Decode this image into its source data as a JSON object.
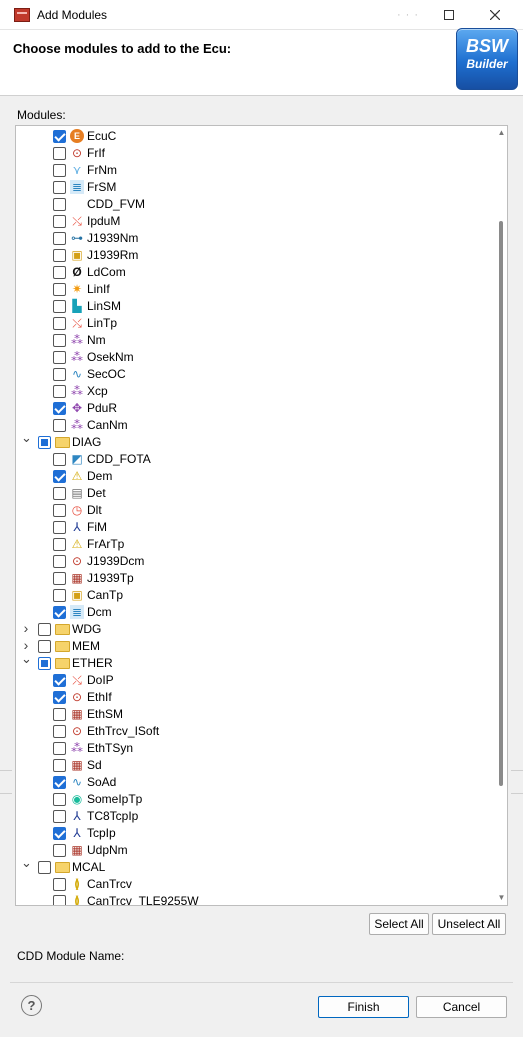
{
  "window": {
    "title": "Add Modules",
    "dots": "· · ·"
  },
  "header": {
    "title": "Choose modules to add to the Ecu:",
    "logo_line1": "BSW",
    "logo_line2": "Builder"
  },
  "modules_label": "Modules:",
  "tree": [
    {
      "label": "EcuC",
      "state": "checked",
      "icon": "ecuc-icon",
      "level": 1
    },
    {
      "label": "FrIf",
      "state": "unchecked",
      "icon": "interface-icon",
      "level": 1
    },
    {
      "label": "FrNm",
      "state": "unchecked",
      "icon": "network-icon",
      "level": 1
    },
    {
      "label": "FrSM",
      "state": "unchecked",
      "icon": "table-icon",
      "level": 1
    },
    {
      "label": "CDD_FVM",
      "state": "unchecked",
      "icon": "",
      "level": 1
    },
    {
      "label": "IpduM",
      "state": "unchecked",
      "icon": "multiplexer-icon",
      "level": 1
    },
    {
      "label": "J1939Nm",
      "state": "unchecked",
      "icon": "link-icon",
      "level": 1
    },
    {
      "label": "J1939Rm",
      "state": "unchecked",
      "icon": "box-icon",
      "level": 1
    },
    {
      "label": "LdCom",
      "state": "unchecked",
      "icon": "phi-icon",
      "level": 1
    },
    {
      "label": "LinIf",
      "state": "unchecked",
      "icon": "star-icon",
      "level": 1
    },
    {
      "label": "LinSM",
      "state": "unchecked",
      "icon": "page-icon",
      "level": 1
    },
    {
      "label": "LinTp",
      "state": "unchecked",
      "icon": "multiplexer-icon",
      "level": 1
    },
    {
      "label": "Nm",
      "state": "unchecked",
      "icon": "nodes-icon",
      "level": 1
    },
    {
      "label": "OsekNm",
      "state": "unchecked",
      "icon": "nodes-icon",
      "level": 1
    },
    {
      "label": "SecOC",
      "state": "unchecked",
      "icon": "wave-icon",
      "level": 1
    },
    {
      "label": "Xcp",
      "state": "unchecked",
      "icon": "nodes-icon",
      "level": 1
    },
    {
      "label": "PduR",
      "state": "checked",
      "icon": "router-icon",
      "level": 1
    },
    {
      "label": "CanNm",
      "state": "unchecked",
      "icon": "nodes-icon",
      "level": 1
    },
    {
      "label": "DIAG",
      "state": "partial",
      "icon": "folder-icon",
      "level": 0,
      "expander": "expanded"
    },
    {
      "label": "CDD_FOTA",
      "state": "unchecked",
      "icon": "puzzle-icon",
      "level": 1
    },
    {
      "label": "Dem",
      "state": "checked",
      "icon": "warning-icon",
      "level": 1
    },
    {
      "label": "Det",
      "state": "unchecked",
      "icon": "clipboard-icon",
      "level": 1
    },
    {
      "label": "Dlt",
      "state": "unchecked",
      "icon": "clock-icon",
      "level": 1
    },
    {
      "label": "FiM",
      "state": "unchecked",
      "icon": "tree-icon",
      "level": 1
    },
    {
      "label": "FrArTp",
      "state": "unchecked",
      "icon": "warning-icon",
      "level": 1
    },
    {
      "label": "J1939Dcm",
      "state": "unchecked",
      "icon": "interface-icon",
      "level": 1
    },
    {
      "label": "J1939Tp",
      "state": "unchecked",
      "icon": "cubes-icon",
      "level": 1
    },
    {
      "label": "CanTp",
      "state": "unchecked",
      "icon": "box-icon",
      "level": 1
    },
    {
      "label": "Dcm",
      "state": "checked",
      "icon": "table-icon",
      "level": 1
    },
    {
      "label": "WDG",
      "state": "unchecked",
      "icon": "folder-icon",
      "level": 0,
      "expander": "collapsed"
    },
    {
      "label": "MEM",
      "state": "unchecked",
      "icon": "folder-icon",
      "level": 0,
      "expander": "collapsed"
    },
    {
      "label": "ETHER",
      "state": "partial",
      "icon": "folder-icon",
      "level": 0,
      "expander": "expanded"
    },
    {
      "label": "DoIP",
      "state": "checked",
      "icon": "multiplexer-icon",
      "level": 1
    },
    {
      "label": "EthIf",
      "state": "checked",
      "icon": "interface-icon",
      "level": 1
    },
    {
      "label": "EthSM",
      "state": "unchecked",
      "icon": "cubes-icon",
      "level": 1
    },
    {
      "label": "EthTrcv_ISoft",
      "state": "unchecked",
      "icon": "interface-icon",
      "level": 1
    },
    {
      "label": "EthTSyn",
      "state": "unchecked",
      "icon": "nodes-icon",
      "level": 1
    },
    {
      "label": "Sd",
      "state": "unchecked",
      "icon": "cubes-icon",
      "level": 1
    },
    {
      "label": "SoAd",
      "state": "checked",
      "icon": "wave-icon",
      "level": 1
    },
    {
      "label": "SomeIpTp",
      "state": "unchecked",
      "icon": "signal-icon",
      "level": 1
    },
    {
      "label": "TC8TcpIp",
      "state": "unchecked",
      "icon": "tree-icon",
      "level": 1
    },
    {
      "label": "TcpIp",
      "state": "checked",
      "icon": "tree-icon",
      "level": 1
    },
    {
      "label": "UdpNm",
      "state": "unchecked",
      "icon": "cubes-icon",
      "level": 1
    },
    {
      "label": "MCAL",
      "state": "unchecked",
      "icon": "folder-icon",
      "level": 0,
      "expander": "expanded"
    },
    {
      "label": "CanTrcv",
      "state": "unchecked",
      "icon": "transceiver-icon",
      "level": 1
    },
    {
      "label": "CanTrcv_TLE9255W",
      "state": "unchecked",
      "icon": "transceiver-icon",
      "level": 1
    }
  ],
  "buttons": {
    "select_all": "Select All",
    "unselect_all": "Unselect All",
    "finish": "Finish",
    "cancel": "Cancel"
  },
  "cdd_label": "CDD Module Name:",
  "help": "?"
}
